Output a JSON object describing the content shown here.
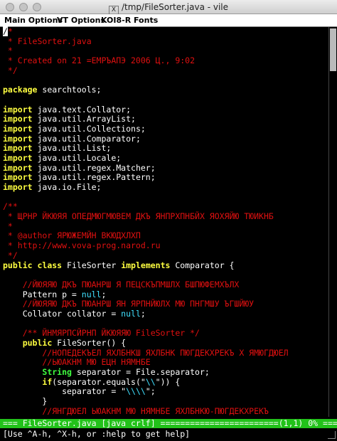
{
  "window": {
    "title": "/tmp/FileSorter.java - vile",
    "app_icon": "x11-icon"
  },
  "menubar": {
    "items": [
      "Main Options",
      "VT Options",
      "KOI8-R Fonts"
    ]
  },
  "editor": {
    "lines": [
      [
        [
          "/",
          "cursor"
        ],
        [
          "*",
          "cmt"
        ]
      ],
      [
        [
          " * FileSorter.java",
          "cmt"
        ]
      ],
      [
        [
          " *",
          "cmt"
        ]
      ],
      [
        [
          " * Created on 21 =ЕМРЪАПЭ 2006 Ц., 9:02",
          "cmt"
        ]
      ],
      [
        [
          " */",
          "cmt"
        ]
      ],
      [
        [
          "",
          ""
        ]
      ],
      [
        [
          "package",
          "kw"
        ],
        [
          " searchtools;",
          ""
        ]
      ],
      [
        [
          "",
          ""
        ]
      ],
      [
        [
          "import",
          "kw"
        ],
        [
          " java.text.Collator;",
          ""
        ]
      ],
      [
        [
          "import",
          "kw"
        ],
        [
          " java.util.ArrayList;",
          ""
        ]
      ],
      [
        [
          "import",
          "kw"
        ],
        [
          " java.util.Collections;",
          ""
        ]
      ],
      [
        [
          "import",
          "kw"
        ],
        [
          " java.util.Comparator;",
          ""
        ]
      ],
      [
        [
          "import",
          "kw"
        ],
        [
          " java.util.List;",
          ""
        ]
      ],
      [
        [
          "import",
          "kw"
        ],
        [
          " java.util.Locale;",
          ""
        ]
      ],
      [
        [
          "import",
          "kw"
        ],
        [
          " java.util.regex.Matcher;",
          ""
        ]
      ],
      [
        [
          "import",
          "kw"
        ],
        [
          " java.util.regex.Pattern;",
          ""
        ]
      ],
      [
        [
          "import",
          "kw"
        ],
        [
          " java.io.File;",
          ""
        ]
      ],
      [
        [
          "",
          ""
        ]
      ],
      [
        [
          "/**",
          "cmt"
        ]
      ],
      [
        [
          " * ЩРНР ЙКЮЯЯ ОПЕДМЮГМЮВЕМ ДКЪ ЯНПРХПНБЙХ ЯОХЯЙЮ ТЮИКНБ",
          "cmt"
        ]
      ],
      [
        [
          " *",
          "cmt"
        ]
      ],
      [
        [
          " * @author ЯРЮЖЕМЙН ВКЮДХЛХП",
          "cmt"
        ]
      ],
      [
        [
          " * http://www.vova-prog.narod.ru",
          "cmt"
        ]
      ],
      [
        [
          " */",
          "cmt"
        ]
      ],
      [
        [
          "public",
          "kw"
        ],
        [
          " ",
          ""
        ],
        [
          "class",
          "kw"
        ],
        [
          " FileSorter ",
          ""
        ],
        [
          "implements",
          "kw"
        ],
        [
          " Comparator {",
          ""
        ]
      ],
      [
        [
          "",
          ""
        ]
      ],
      [
        [
          "    //ЙЮЯЯЮ ДКЪ ПЮАНРШ Я ПЕЦСКЪПМШЛХ БШПЮФЕМХЪЛХ",
          "cmt"
        ]
      ],
      [
        [
          "    Pattern p = ",
          ""
        ],
        [
          "null",
          "cy"
        ],
        [
          ";",
          ""
        ]
      ],
      [
        [
          "    //ЙЮЯЯЮ ДКЪ ПЮАНРШ ЯН ЯРПНЙЮЛХ МЮ ПНГМШУ ЪГШЙЮУ",
          "cmt"
        ]
      ],
      [
        [
          "    Collator collator = ",
          ""
        ],
        [
          "null",
          "cy"
        ],
        [
          ";",
          ""
        ]
      ],
      [
        [
          "",
          ""
        ]
      ],
      [
        [
          "    /** ЙНМЯРПСЙРНП ЙКЮЯЯЮ FileSorter */",
          "cmt"
        ]
      ],
      [
        [
          "    ",
          ""
        ],
        [
          "public",
          "kw"
        ],
        [
          " FileSorter() {",
          ""
        ]
      ],
      [
        [
          "        //НОПЕДЕКЪЕЛ ЯХЛБНКШ ЯХЛБНК ПЮГДЕКХРЕКЪ Х ЯМЮГДЮЕЛ",
          "cmt"
        ]
      ],
      [
        [
          "        //ЬЮАКНМ МЮ ЕЦН НЯМНБЕ",
          "cmt"
        ]
      ],
      [
        [
          "        ",
          ""
        ],
        [
          "String",
          "ty"
        ],
        [
          " separator = File.separator;",
          ""
        ]
      ],
      [
        [
          "        ",
          ""
        ],
        [
          "if",
          "kw"
        ],
        [
          "(separator.equals(\"",
          ""
        ],
        [
          "\\\\",
          "cy"
        ],
        [
          "\")) {",
          ""
        ]
      ],
      [
        [
          "            separator = \"",
          ""
        ],
        [
          "\\\\\\\\",
          "cy"
        ],
        [
          "\";",
          ""
        ]
      ],
      [
        [
          "        }",
          ""
        ]
      ],
      [
        [
          "        //ЯНГДЮЕЛ ЬЮАКНМ МЮ НЯМНБЕ ЯХЛБНКЮ-ПЮГДЕКХРЕКЪ",
          "cmt"
        ]
      ]
    ]
  },
  "statusbar": {
    "text": "=== FileSorter.java [java crlf] ========================(1,1) 0% ==="
  },
  "cmdline": {
    "text": "[Use ^A-h, ^X-h, or :help to get help]"
  },
  "colors": {
    "comment": "#e01010",
    "keyword": "#ffff40",
    "type": "#40ff40",
    "literal": "#40e0ff",
    "status": "#22c21a"
  }
}
